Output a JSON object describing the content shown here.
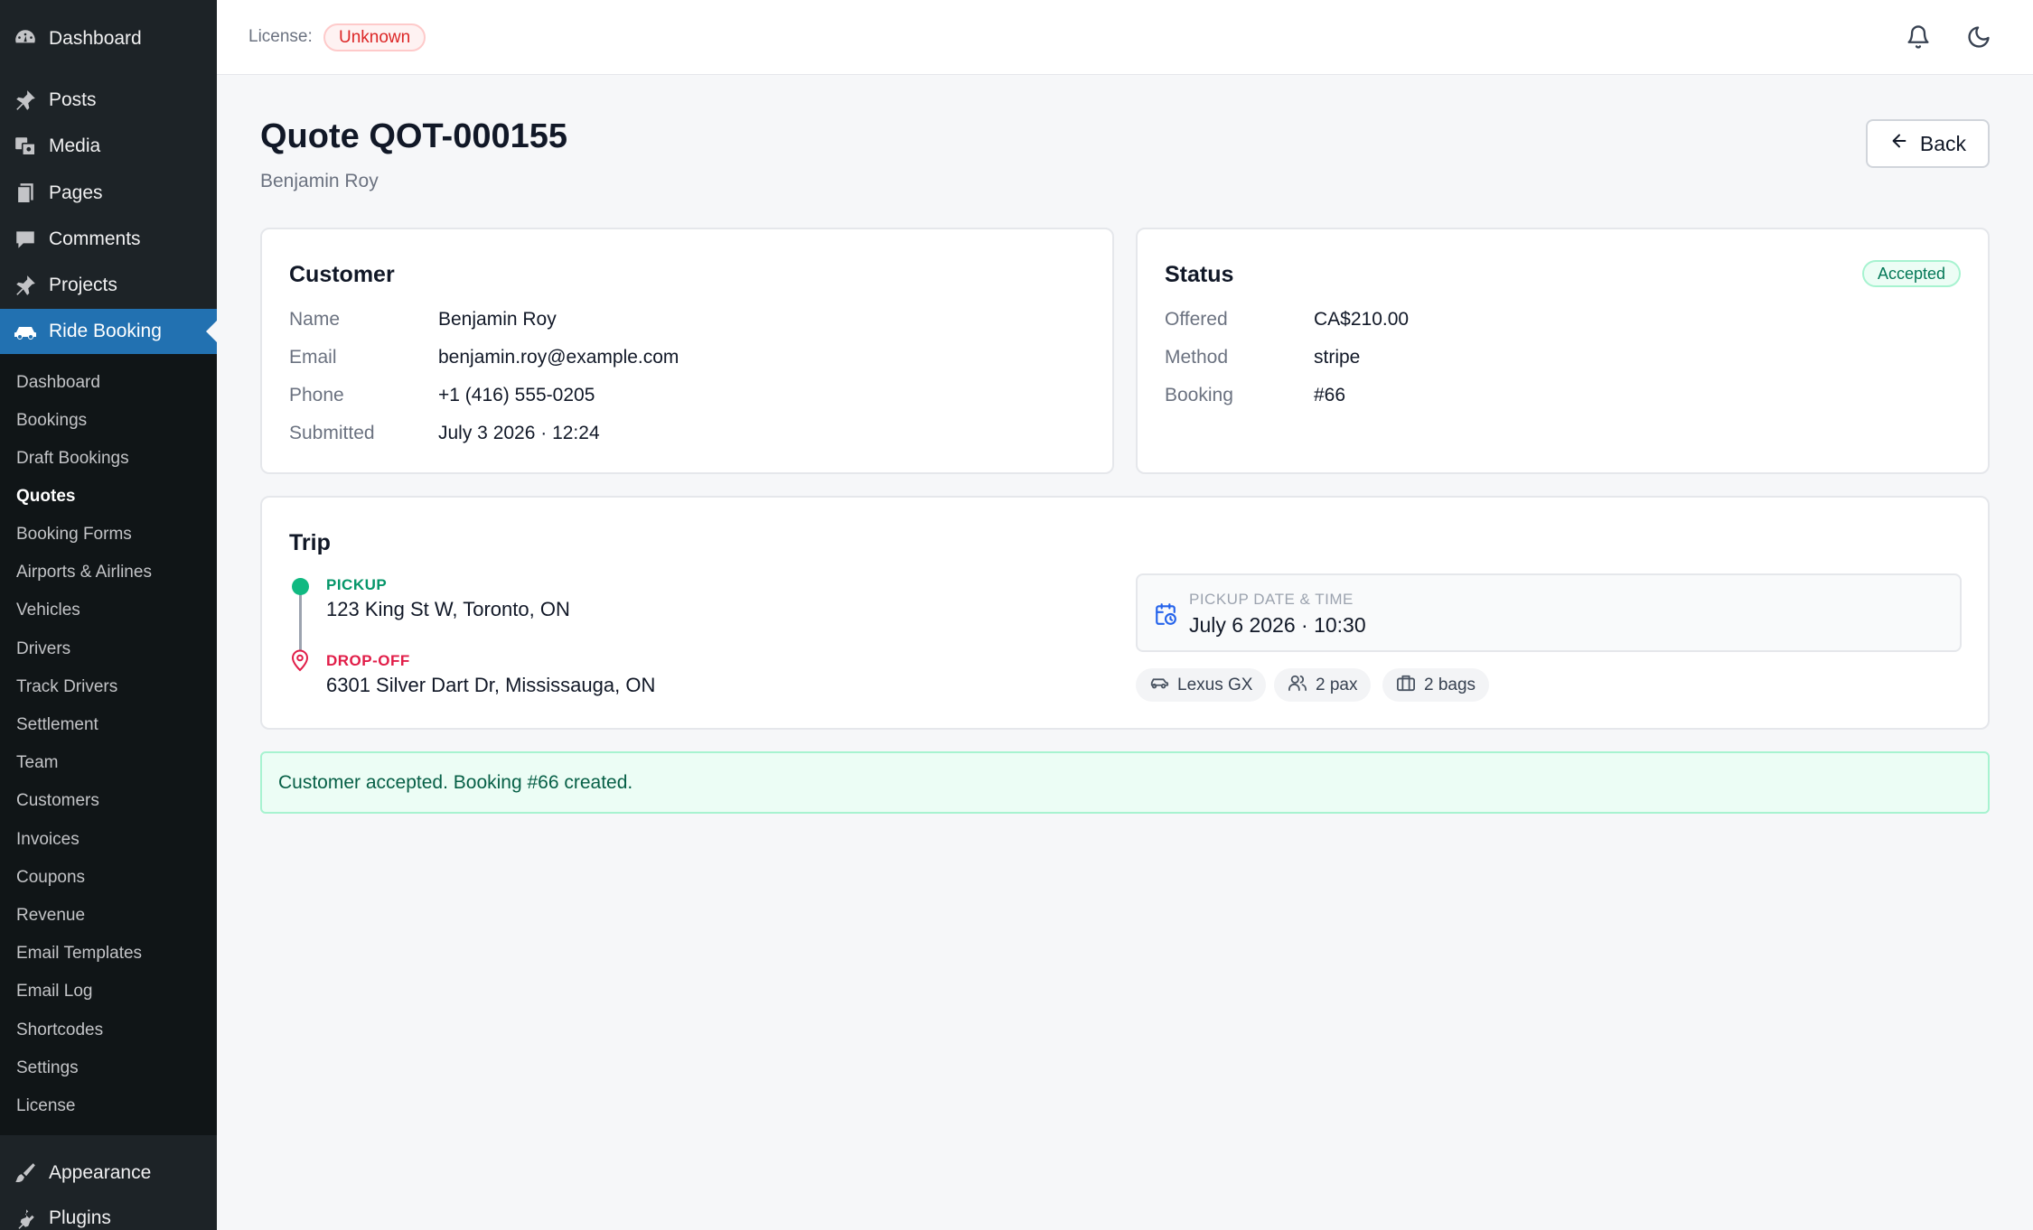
{
  "sidebar": {
    "top_items": [
      {
        "label": "Dashboard",
        "icon": "dashboard-icon"
      }
    ],
    "items": [
      {
        "label": "Posts",
        "icon": "pushpin-icon"
      },
      {
        "label": "Media",
        "icon": "media-icon"
      },
      {
        "label": "Pages",
        "icon": "pages-icon"
      },
      {
        "label": "Comments",
        "icon": "comment-icon"
      },
      {
        "label": "Projects",
        "icon": "pushpin-icon"
      },
      {
        "label": "Ride Booking",
        "icon": "car-icon",
        "active": true
      }
    ],
    "submenu": [
      "Dashboard",
      "Bookings",
      "Draft Bookings",
      "Quotes",
      "Booking Forms",
      "Airports & Airlines",
      "Vehicles",
      "Drivers",
      "Track Drivers",
      "Settlement",
      "Team",
      "Customers",
      "Invoices",
      "Coupons",
      "Revenue",
      "Email Templates",
      "Email Log",
      "Shortcodes",
      "Settings",
      "License"
    ],
    "current_submenu": "Quotes",
    "bottom_items": [
      {
        "label": "Appearance",
        "icon": "brush-icon"
      },
      {
        "label": "Plugins",
        "icon": "plugin-icon"
      }
    ]
  },
  "header": {
    "license_label": "License:",
    "license_status": "Unknown"
  },
  "page": {
    "title": "Quote QOT-000155",
    "subtitle": "Benjamin Roy",
    "back_label": "Back"
  },
  "customer": {
    "title": "Customer",
    "rows": [
      {
        "label": "Name",
        "value": "Benjamin Roy"
      },
      {
        "label": "Email",
        "value": "benjamin.roy@example.com"
      },
      {
        "label": "Phone",
        "value": "+1 (416) 555-0205"
      },
      {
        "label": "Submitted",
        "value": "July 3 2026 · 12:24"
      }
    ]
  },
  "status": {
    "title": "Status",
    "badge": "Accepted",
    "rows": [
      {
        "label": "Offered",
        "value": "CA$210.00"
      },
      {
        "label": "Method",
        "value": "stripe"
      },
      {
        "label": "Booking",
        "value": "#66"
      }
    ]
  },
  "trip": {
    "title": "Trip",
    "pickup_label": "PICKUP",
    "pickup_address": "123 King St W, Toronto, ON",
    "dropoff_label": "DROP-OFF",
    "dropoff_address": "6301 Silver Dart Dr, Mississauga, ON",
    "datetime_label": "PICKUP DATE & TIME",
    "datetime_value": "July 6 2026 · 10:30",
    "vehicle": "Lexus GX",
    "passengers": "2 pax",
    "bags": "2 bags"
  },
  "alert": {
    "message": "Customer accepted. Booking #66 created."
  },
  "colors": {
    "sidebar_bg": "#1d2327",
    "active_bg": "#2271b1",
    "accent_green": "#10b981",
    "accent_red": "#e11d48"
  }
}
